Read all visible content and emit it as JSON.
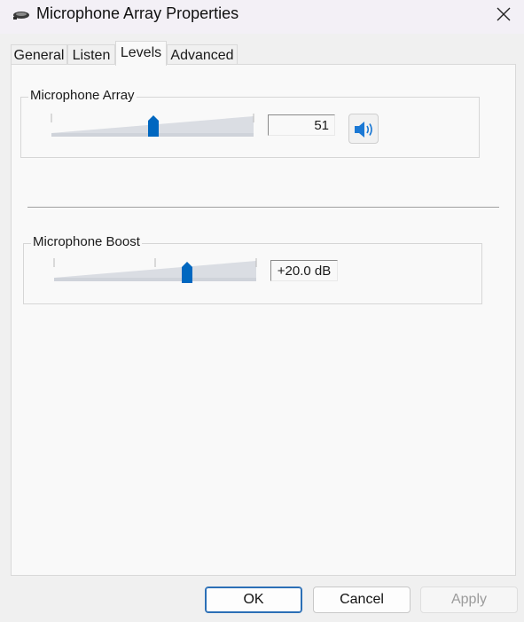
{
  "window": {
    "title": "Microphone Array Properties",
    "icon": "microphone-device-icon"
  },
  "tabs": [
    {
      "label": "General",
      "active": false
    },
    {
      "label": "Listen",
      "active": false
    },
    {
      "label": "Levels",
      "active": true
    },
    {
      "label": "Advanced",
      "active": false
    }
  ],
  "levels": {
    "mic_array": {
      "label": "Microphone Array",
      "value": "51",
      "slider_fraction": 0.51,
      "mute_icon": "speaker-unmuted-icon"
    },
    "mic_boost": {
      "label": "Microphone Boost",
      "value": "+20.0 dB",
      "slider_fraction": 0.667
    }
  },
  "buttons": {
    "ok": "OK",
    "cancel": "Cancel",
    "apply": "Apply",
    "apply_enabled": false
  },
  "colors": {
    "accent": "#0067c0",
    "track": "#dadde3"
  }
}
